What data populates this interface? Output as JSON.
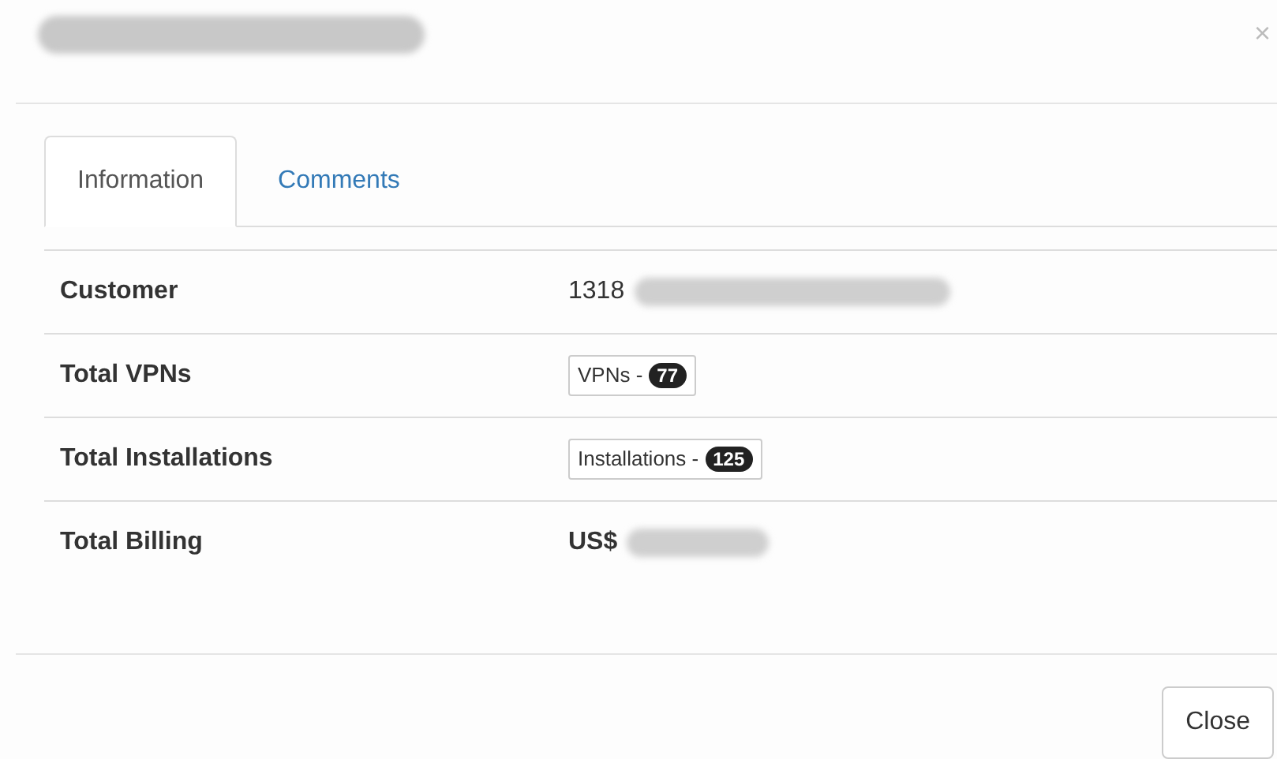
{
  "header": {
    "title_redacted": true,
    "close": "×"
  },
  "tabs": [
    {
      "label": "Information",
      "selected": true
    },
    {
      "label": "Comments",
      "selected": false
    }
  ],
  "rows": [
    {
      "label": "Customer",
      "kind": "text",
      "value": "1318",
      "redacted": true
    },
    {
      "label": "Total VPNs",
      "kind": "badge",
      "value": "VPNs -",
      "count": "77",
      "redacted": false
    },
    {
      "label": "Total Installations",
      "kind": "badge",
      "value": "Installations -",
      "count": "125",
      "redacted": false
    },
    {
      "label": "Total Billing",
      "kind": "money",
      "value": "US$",
      "redacted": true
    }
  ],
  "footer": {
    "button": "Close"
  }
}
